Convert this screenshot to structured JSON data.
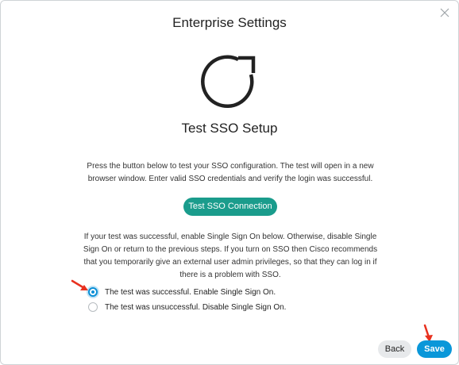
{
  "dialog": {
    "title": "Enterprise Settings",
    "close_icon": "close-icon",
    "main_icon": "refresh-icon",
    "subtitle": "Test SSO Setup",
    "description": "Press the button below to test your SSO configuration. The test will open in a new browser window. Enter valid SSO credentials and verify the login was successful.",
    "test_button_label": "Test SSO Connection",
    "info_text": "If your test was successful, enable Single Sign On below. Otherwise, disable Single Sign On or return to the previous steps. If you turn on SSO then Cisco recommends that you temporarily give an external user admin privileges, so that they can log in if there is a problem with SSO.",
    "options": [
      {
        "label": "The test was successful. Enable Single Sign On.",
        "selected": true
      },
      {
        "label": "The test was unsuccessful. Disable Single Sign On.",
        "selected": false
      }
    ]
  },
  "footer": {
    "back_label": "Back",
    "save_label": "Save"
  },
  "colors": {
    "test_button": "#1a9c8c",
    "save_button": "#0a97d9",
    "radio_selected": "#0b8fd6",
    "annotation_arrow": "#e8311f"
  }
}
